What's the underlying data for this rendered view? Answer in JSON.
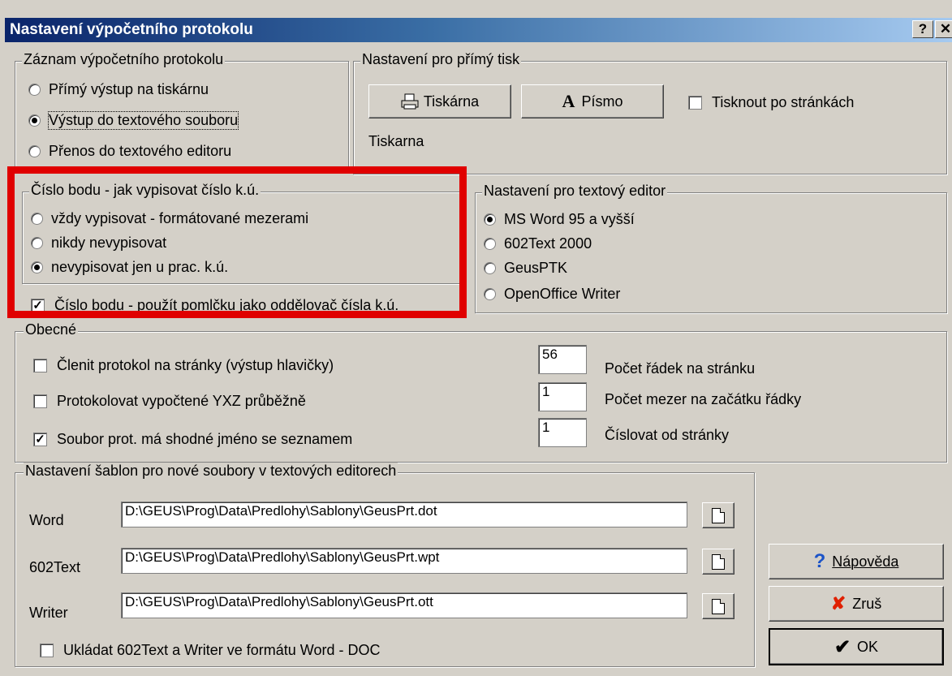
{
  "window": {
    "title": "Nastavení výpočetního protokolu",
    "help_btn": "?",
    "close_btn": "✕"
  },
  "output_group": {
    "legend": "Záznam výpočetního protokolu",
    "options": [
      "Přímý výstup na tiskárnu",
      "Výstup do textového souboru",
      "Přenos do textového editoru"
    ],
    "selected_index": 1
  },
  "print_group": {
    "legend": "Nastavení pro přímý tisk",
    "printer_button": "Tiskárna",
    "font_button": "Písmo",
    "font_glyph": "A",
    "paged_checkbox": "Tisknout po stránkách",
    "paged_checked": false,
    "printer_name": "Tiskarna"
  },
  "point_group": {
    "legend": "Číslo bodu - jak vypisovat číslo k.ú.",
    "options": [
      "vždy vypisovat - formátované mezerami",
      "nikdy nevypisovat",
      "nevypisovat jen u prac. k.ú."
    ],
    "selected_index": 2,
    "dash_checkbox": "Číslo bodu - použít pomlčku jako oddělovač čísla k.ú.",
    "dash_checked": true
  },
  "editor_group": {
    "legend": "Nastavení pro textový editor",
    "options": [
      "MS Word 95 a vyšší",
      "602Text 2000",
      "GeusPTK",
      "OpenOffice Writer"
    ],
    "selected_index": 0
  },
  "general_group": {
    "legend": "Obecné",
    "checkboxes": [
      {
        "label": "Členit protokol na stránky (výstup hlavičky)",
        "checked": false
      },
      {
        "label": "Protokolovat vypočtené YXZ průběžně",
        "checked": false
      },
      {
        "label": "Soubor prot. má shodné jméno se seznamem",
        "checked": true
      }
    ],
    "fields": [
      {
        "value": "56",
        "label": "Počet řádek na stránku"
      },
      {
        "value": "1",
        "label": "Počet mezer na začátku řádky"
      },
      {
        "value": "1",
        "label": "Číslovat od stránky"
      }
    ]
  },
  "templates_group": {
    "legend": "Nastavení šablon pro nové soubory v textových  editorech",
    "rows": [
      {
        "label": "Word",
        "path": "D:\\GEUS\\Prog\\Data\\Predlohy\\Sablony\\GeusPrt.dot"
      },
      {
        "label": "602Text",
        "path": "D:\\GEUS\\Prog\\Data\\Predlohy\\Sablony\\GeusPrt.wpt"
      },
      {
        "label": "Writer",
        "path": "D:\\GEUS\\Prog\\Data\\Predlohy\\Sablony\\GeusPrt.ott"
      }
    ],
    "doc_checkbox": "Ukládat 602Text a Writer ve formátu Word - DOC",
    "doc_checked": false
  },
  "buttons": {
    "help": "Nápověda",
    "cancel": "Zruš",
    "ok": "OK"
  },
  "colors": {
    "highlight": "#e00000",
    "title_start": "#0a246a",
    "title_end": "#a6caf0",
    "face": "#d4d0c8"
  }
}
